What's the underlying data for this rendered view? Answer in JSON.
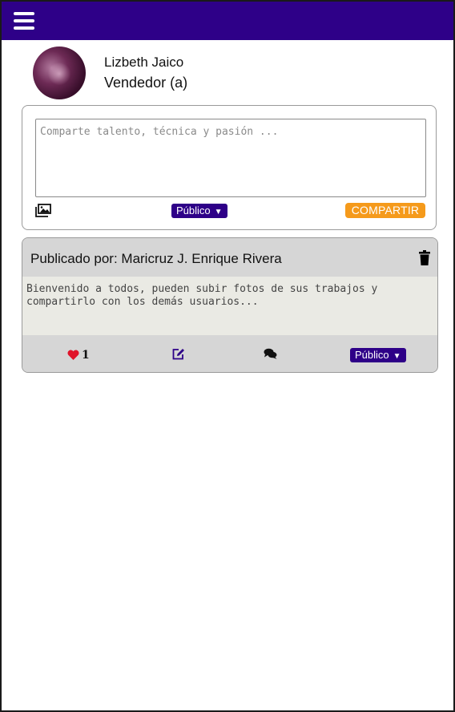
{
  "header": {
    "menu_icon": "hamburger-icon"
  },
  "profile": {
    "name": "Lizbeth Jaico",
    "role": "Vendedor (a)"
  },
  "composer": {
    "placeholder": "Comparte talento, técnica y pasión ...",
    "image_icon": "images-icon",
    "privacy": "Público",
    "share_label": "COMPARTIR"
  },
  "post": {
    "author_line": "Publicado por: Maricruz J. Enrique Rivera",
    "body": "Bienvenido a todos, pueden subir fotos de sus trabajos y\ncompartirlo con los demás usuarios...",
    "likes": "1",
    "privacy": "Público",
    "icons": [
      "heart-icon",
      "edit-icon",
      "comments-icon",
      "trash-icon"
    ]
  },
  "colors": {
    "brand": "#2e0088",
    "accent": "#f59a1b",
    "like": "#e0142a"
  }
}
